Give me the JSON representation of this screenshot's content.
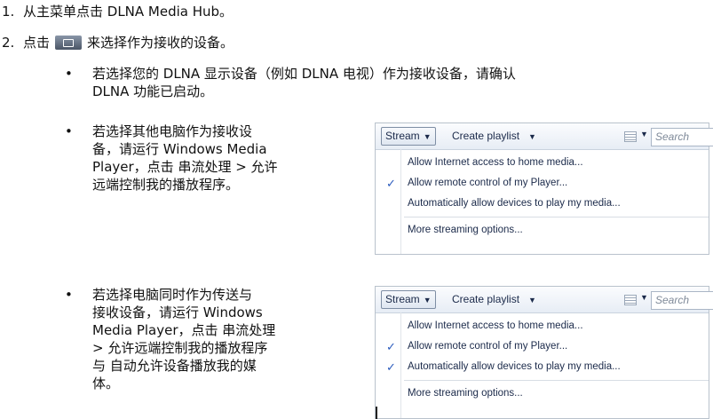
{
  "steps": [
    {
      "num": "1.",
      "text": "从主菜单点击 DLNA Media Hub。"
    },
    {
      "num": "2.",
      "before_icon": "点击",
      "after_icon": "来选择作为接收的设备。"
    }
  ],
  "bullets": [
    {
      "dot": "•",
      "lines": [
        "若选择您的 DLNA 显示设备（例如 DLNA 电视）作为接收设备，请确认",
        "DLNA 功能已启动。"
      ]
    },
    {
      "dot": "•",
      "lines": [
        "若选择其他电脑作为接收设",
        "备，请运行 Windows Media",
        "Player，点击 串流处理 > 允许",
        "远端控制我的播放程序。"
      ]
    },
    {
      "dot": "•",
      "lines": [
        "若选择电脑同时作为传送与",
        "接收设备，请运行 Windows",
        "Media Player，点击 串流处理",
        "> 允许远端控制我的播放程序",
        "与 自动允许设备播放我的媒",
        "体。"
      ]
    }
  ],
  "menus": [
    {
      "stream_label": "Stream",
      "create_playlist": "Create playlist",
      "search_placeholder": "Search",
      "items": [
        {
          "label": "Allow Internet access to home media...",
          "checked": false
        },
        {
          "label": "Allow remote control of my Player...",
          "checked": true
        },
        {
          "label": "Automatically allow devices to play my media...",
          "checked": false
        },
        {
          "label": "More streaming options...",
          "checked": false
        }
      ]
    },
    {
      "stream_label": "Stream",
      "create_playlist": "Create playlist",
      "search_placeholder": "Search",
      "items": [
        {
          "label": "Allow Internet access to home media...",
          "checked": false
        },
        {
          "label": "Allow remote control of my Player...",
          "checked": true
        },
        {
          "label": "Automatically allow devices to play my media...",
          "checked": true
        },
        {
          "label": "More streaming options...",
          "checked": false
        }
      ]
    }
  ],
  "icons": {
    "select_device": "device-select-icon",
    "check": "checkmark-icon"
  }
}
